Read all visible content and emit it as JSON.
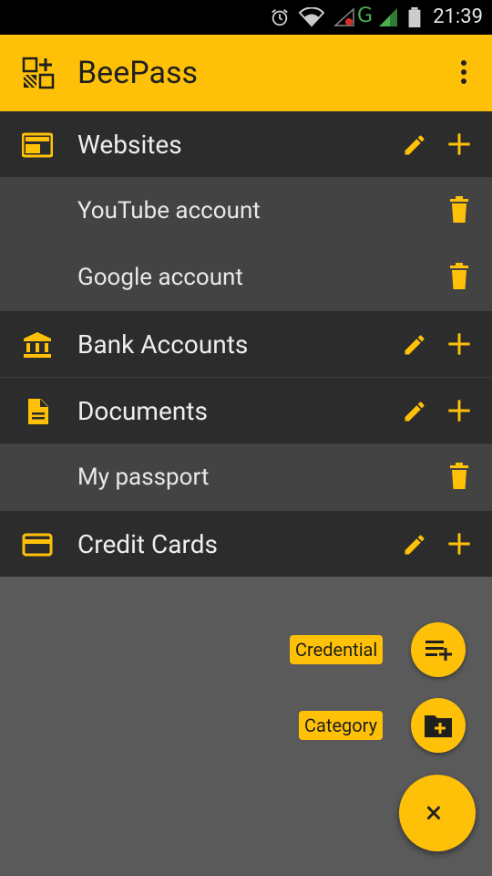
{
  "status_bar": {
    "time": "21:39",
    "network": "G"
  },
  "app": {
    "title": "BeePass"
  },
  "rows": [
    {
      "type": "category",
      "label": "Websites",
      "icon": "web-icon"
    },
    {
      "type": "item",
      "label": "YouTube account"
    },
    {
      "type": "item",
      "label": "Google account"
    },
    {
      "type": "category",
      "label": "Bank Accounts",
      "icon": "bank-icon"
    },
    {
      "type": "category",
      "label": "Documents",
      "icon": "document-icon"
    },
    {
      "type": "item",
      "label": "My passport"
    },
    {
      "type": "category",
      "label": "Credit Cards",
      "icon": "credit-card-icon"
    }
  ],
  "fab_menu": {
    "credential_label": "Credential",
    "category_label": "Category",
    "close_symbol": "×"
  },
  "colors": {
    "accent": "#FFC107",
    "category_bg": "#2c2c2c",
    "item_bg": "#434343",
    "background": "#5a5a5a"
  }
}
